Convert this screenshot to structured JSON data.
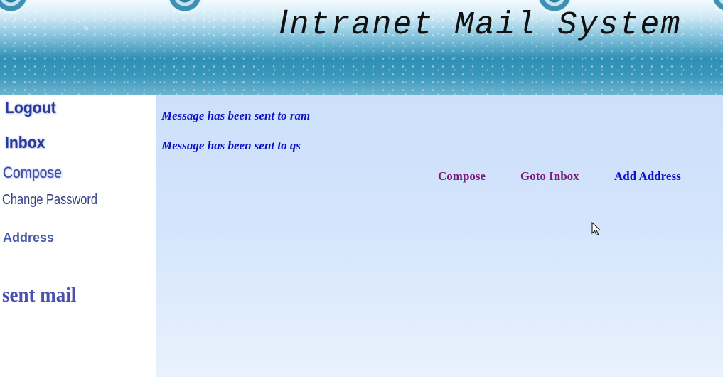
{
  "header": {
    "title_first": "I",
    "title_rest": "ntranet Mail System"
  },
  "sidebar": {
    "logout": "Logout",
    "inbox": "Inbox",
    "compose": "Compose",
    "change_password": "Change Password",
    "address": "Address",
    "sent_mail": "sent mail"
  },
  "main": {
    "messages": [
      "Message has been sent to ram",
      "Message has been sent to qs"
    ],
    "links": {
      "compose": "Compose",
      "goto_inbox": "Goto Inbox",
      "add_address": "Add Address"
    }
  },
  "colors": {
    "message_text": "#0b10c8",
    "visited_link": "#7a1a7a",
    "link": "#1010c8",
    "content_bg": "#cde0fb"
  },
  "icons": {
    "cursor": "mouse-pointer-icon"
  }
}
